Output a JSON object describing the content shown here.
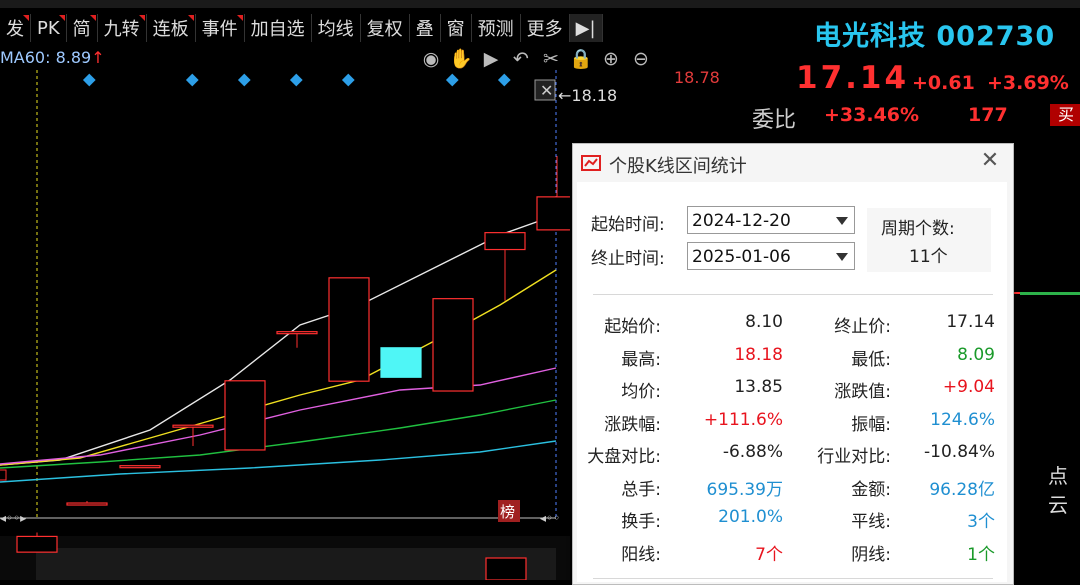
{
  "toolbar": {
    "items": [
      "发",
      "PK",
      "简",
      "九转",
      "连板",
      "事件",
      "加自选",
      "均线",
      "复权",
      "叠",
      "窗",
      "预测",
      "更多"
    ],
    "flagged": [
      true,
      true,
      true,
      true,
      true,
      true,
      false,
      false,
      false,
      false,
      false,
      false,
      false
    ]
  },
  "ma_info": {
    "text": "MA60: 8.89",
    "arrow": "↑"
  },
  "chart": {
    "price_high_axis": "18.78",
    "high_marker": "18.18",
    "tag_label": "榜"
  },
  "chart_data": {
    "type": "candlestick",
    "dates_start": "2024-12-20",
    "dates_end": "2025-01-06",
    "ohlc": [
      [
        8.1,
        8.6,
        8.09,
        8.5
      ],
      [
        9.35,
        9.4,
        9.3,
        9.35
      ],
      [
        10.3,
        10.3,
        10.3,
        10.3
      ],
      [
        11.33,
        11.33,
        10.8,
        11.33
      ],
      [
        10.7,
        12.46,
        10.7,
        12.46
      ],
      [
        13.71,
        13.71,
        13.3,
        13.71
      ],
      [
        12.45,
        15.08,
        12.45,
        15.08
      ],
      [
        12.55,
        13.3,
        12.55,
        13.3
      ],
      [
        14.55,
        14.55,
        12.2,
        12.2
      ],
      [
        16.23,
        16.23,
        14.5,
        15.8
      ],
      [
        17.14,
        18.18,
        16.4,
        16.3
      ]
    ]
  },
  "quote": {
    "name": "电光科技 002730",
    "price": "17.14",
    "change": "+0.61",
    "change_pct": "+3.69%",
    "weibi_label": "委比",
    "weibi_value": "+33.46%",
    "weibi_num": "177",
    "buy_tag": "买",
    "point_label": "点云"
  },
  "dialog": {
    "title": "个股K线区间统计",
    "start_label": "起始时间:",
    "start_value": "2024-12-20",
    "end_label": "终止时间:",
    "end_value": "2025-01-06",
    "period_label": "周期个数:",
    "period_value": "11个",
    "stats": [
      {
        "k1": "起始价:",
        "v1": "8.10",
        "c1": "c-black",
        "k2": "终止价:",
        "v2": "17.14",
        "c2": "c-black"
      },
      {
        "k1": "最高:",
        "v1": "18.18",
        "c1": "c-red",
        "k2": "最低:",
        "v2": "8.09",
        "c2": "c-green"
      },
      {
        "k1": "均价:",
        "v1": "13.85",
        "c1": "c-black",
        "k2": "涨跌值:",
        "v2": "+9.04",
        "c2": "c-red"
      },
      {
        "k1": "涨跌幅:",
        "v1": "+111.6%",
        "c1": "c-red",
        "k2": "振幅:",
        "v2": "124.6%",
        "c2": "c-blue"
      },
      {
        "k1": "大盘对比:",
        "v1": "-6.88%",
        "c1": "c-black",
        "k2": "行业对比:",
        "v2": "-10.84%",
        "c2": "c-black"
      },
      {
        "k1": "总手:",
        "v1": "695.39万",
        "c1": "c-blue",
        "k2": "金额:",
        "v2": "96.28亿",
        "c2": "c-blue"
      },
      {
        "k1": "换手:",
        "v1": "201.0%",
        "c1": "c-blue",
        "k2": "平线:",
        "v2": "3个",
        "c2": "c-blue"
      },
      {
        "k1": "阳线:",
        "v1": "7个",
        "c1": "c-red",
        "k2": "阴线:",
        "v2": "1个",
        "c2": "c-green"
      }
    ]
  },
  "colors": {
    "up": "#ff3030",
    "down_fill": "#000000",
    "cyan": "#4ff6f6",
    "accent": "#29c6ef"
  }
}
